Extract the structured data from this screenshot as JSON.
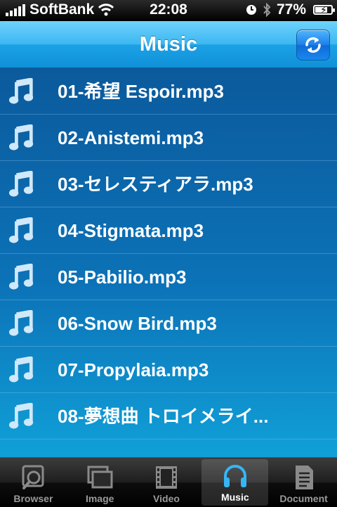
{
  "status_bar": {
    "carrier": "SoftBank",
    "time": "22:08",
    "battery": "77%",
    "battery_level": 0.77
  },
  "nav": {
    "title": "Music",
    "refresh_icon": "refresh-icon"
  },
  "list": {
    "items": [
      {
        "label": "01-希望 Espoir.mp3"
      },
      {
        "label": "02-Anistemi.mp3"
      },
      {
        "label": "03-セレスティアラ.mp3"
      },
      {
        "label": "04-Stigmata.mp3"
      },
      {
        "label": "05-Pabilio.mp3"
      },
      {
        "label": "06-Snow Bird.mp3"
      },
      {
        "label": "07-Propylaia.mp3"
      },
      {
        "label": "08-夢想曲 トロイメライ..."
      }
    ]
  },
  "tabs": [
    {
      "label": "Browser",
      "icon": "browser-icon",
      "selected": false
    },
    {
      "label": "Image",
      "icon": "image-icon",
      "selected": false
    },
    {
      "label": "Video",
      "icon": "video-icon",
      "selected": false
    },
    {
      "label": "Music",
      "icon": "headphones-icon",
      "selected": true
    },
    {
      "label": "Document",
      "icon": "document-icon",
      "selected": false
    }
  ],
  "colors": {
    "nav_gradient_top": "#6fd2fb",
    "list_top": "#0b5a9c",
    "list_bottom": "#10a0d8",
    "music_tab_accent": "#35b5f5"
  }
}
